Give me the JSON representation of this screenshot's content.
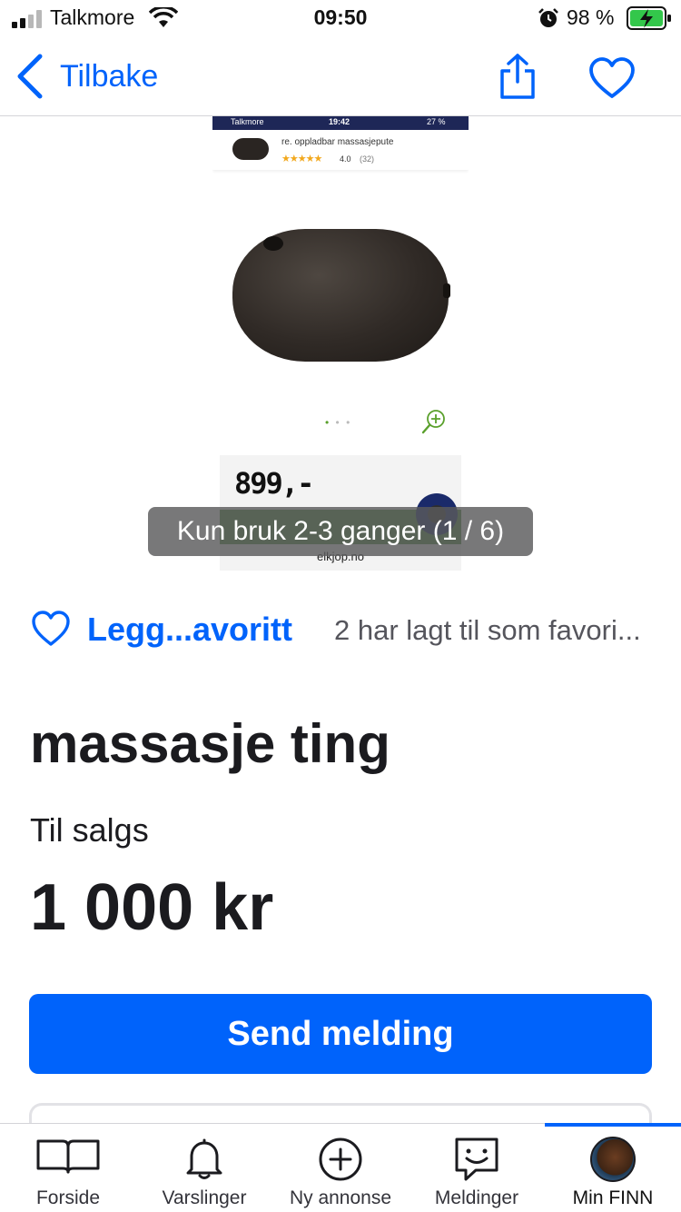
{
  "status_bar": {
    "carrier": "Talkmore",
    "time": "09:50",
    "battery_percent": "98 %"
  },
  "nav": {
    "back_label": "Tilbake"
  },
  "gallery": {
    "screenshot": {
      "carrier": "Talkmore",
      "time": "19:42",
      "battery": "27 %",
      "product_title": "re. oppladbar massasjepute",
      "stars": "★★★★★",
      "rating": "4.0",
      "review_count": "(32)",
      "page_dots": "• • •",
      "price": "899,-",
      "domain": "elkjop.no"
    },
    "caption": "Kun bruk 2-3 ganger  (1 / 6)"
  },
  "favorite": {
    "label": "Legg...avoritt",
    "count_text": "2 har lagt til som favori..."
  },
  "ad": {
    "title": "massasje ting",
    "type": "Til salgs",
    "price": "1 000 kr",
    "send_button": "Send melding"
  },
  "tabs": [
    {
      "label": "Forside",
      "icon": "book-icon"
    },
    {
      "label": "Varslinger",
      "icon": "bell-icon"
    },
    {
      "label": "Ny annonse",
      "icon": "plus-circle-icon"
    },
    {
      "label": "Meldinger",
      "icon": "chat-icon"
    },
    {
      "label": "Min FINN",
      "icon": "avatar",
      "active": true
    }
  ],
  "colors": {
    "accent": "#0063fb",
    "text": "#1b1b1f",
    "muted": "#55555c"
  }
}
